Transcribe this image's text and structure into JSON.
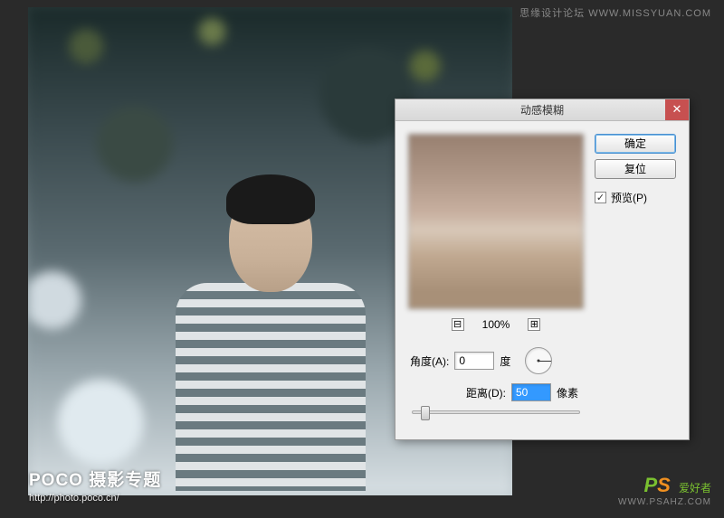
{
  "watermarks": {
    "top_right": "思缘设计论坛  WWW.MISSYUAN.COM",
    "bottom_left_brand": "POCO",
    "bottom_left_subject": "摄影专题",
    "bottom_left_url": "http://photo.poco.cn/",
    "bottom_right_logo_part1": "P",
    "bottom_right_logo_part2": "S",
    "bottom_right_text": "爱好者",
    "bottom_right_url": "WWW.PSAHZ.COM"
  },
  "dialog": {
    "title": "动感模糊",
    "ok_label": "确定",
    "reset_label": "复位",
    "preview_checkbox_label": "预览(P)",
    "preview_checked": true,
    "zoom": {
      "minus": "⊟",
      "plus": "⊞",
      "level": "100%"
    },
    "angle": {
      "label": "角度(A):",
      "value": "0",
      "unit": "度"
    },
    "distance": {
      "label": "距离(D):",
      "value": "50",
      "unit": "像素"
    }
  }
}
